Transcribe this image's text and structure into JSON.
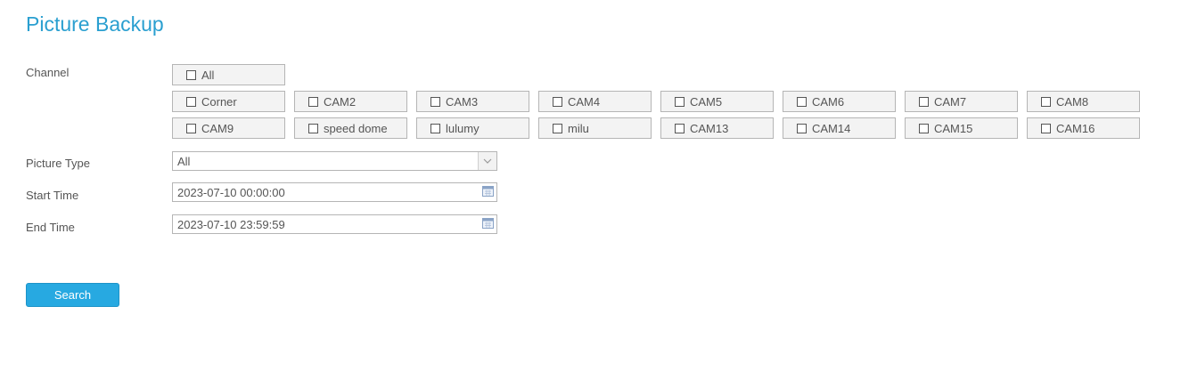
{
  "page": {
    "title": "Picture Backup"
  },
  "channel": {
    "label": "Channel",
    "all_label": "All",
    "row1": [
      "Corner",
      "CAM2",
      "CAM3",
      "CAM4",
      "CAM5",
      "CAM6",
      "CAM7",
      "CAM8"
    ],
    "row2": [
      "CAM9",
      "speed dome",
      "lulumy",
      "milu",
      "CAM13",
      "CAM14",
      "CAM15",
      "CAM16"
    ]
  },
  "picture_type": {
    "label": "Picture Type",
    "value": "All"
  },
  "start_time": {
    "label": "Start Time",
    "value": "2023-07-10 00:00:00"
  },
  "end_time": {
    "label": "End Time",
    "value": "2023-07-10 23:59:59"
  },
  "search": {
    "label": "Search"
  },
  "icons": {
    "dropdown": "chevron-down-icon",
    "calendar": "calendar-icon",
    "checkbox": "checkbox-unchecked-icon"
  },
  "colors": {
    "accent": "#2a9fd0",
    "button": "#27a9e1"
  }
}
